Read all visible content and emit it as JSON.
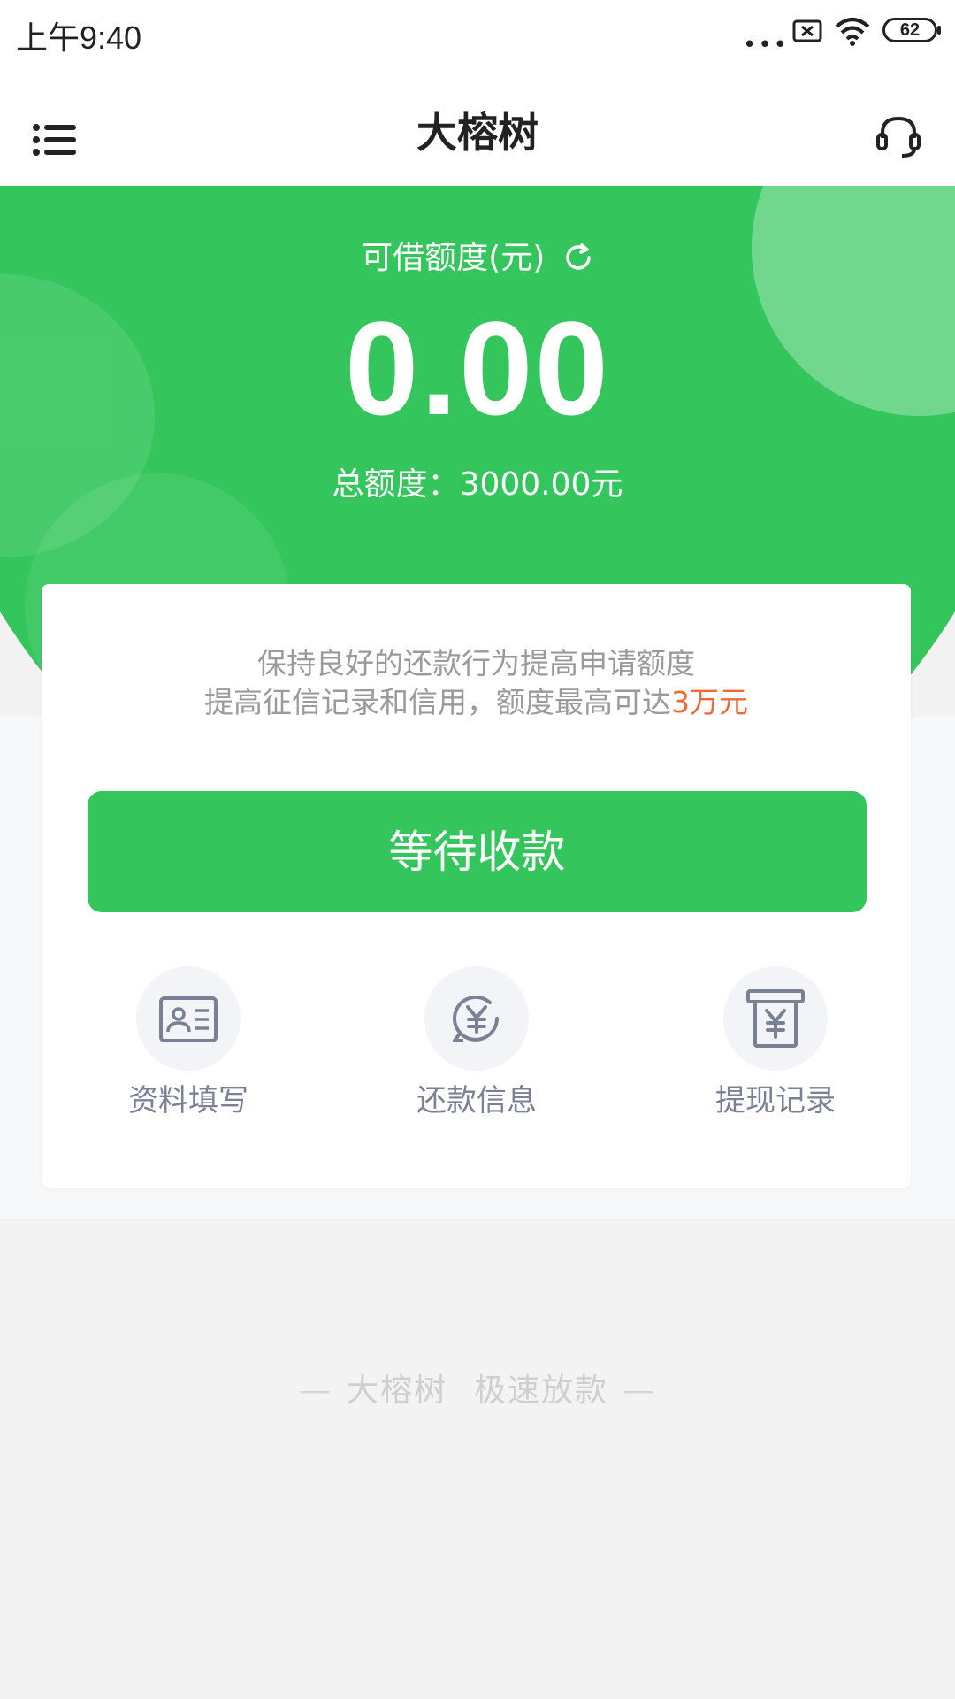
{
  "status_bar": {
    "time": "上午9:40",
    "dots": "•••",
    "battery": "62"
  },
  "header": {
    "title": "大榕树",
    "menu_icon": "list-icon",
    "service_icon": "headset-icon"
  },
  "hero": {
    "limit_label": "可借额度(元)",
    "available_amount": "0.00",
    "total_limit": "总额度：3000.00元"
  },
  "card": {
    "tip_line1": "保持良好的还款行为提高申请额度",
    "tip_line2": "提高征信记录和信用，额度最高可达",
    "tip_highlight": "3万元",
    "primary_button": "等待收款",
    "quick_links": [
      {
        "label": "资料填写",
        "icon": "id-card-icon"
      },
      {
        "label": "还款信息",
        "icon": "yuan-refresh-icon"
      },
      {
        "label": "提现记录",
        "icon": "yuan-receipt-icon"
      }
    ]
  },
  "footer": {
    "brand": "大榕树",
    "slogan": "极速放款",
    "dash": "—"
  },
  "colors": {
    "brand_green": "#34c65c",
    "highlight_orange": "#f06a35",
    "icon_gray": "#7a8194"
  }
}
